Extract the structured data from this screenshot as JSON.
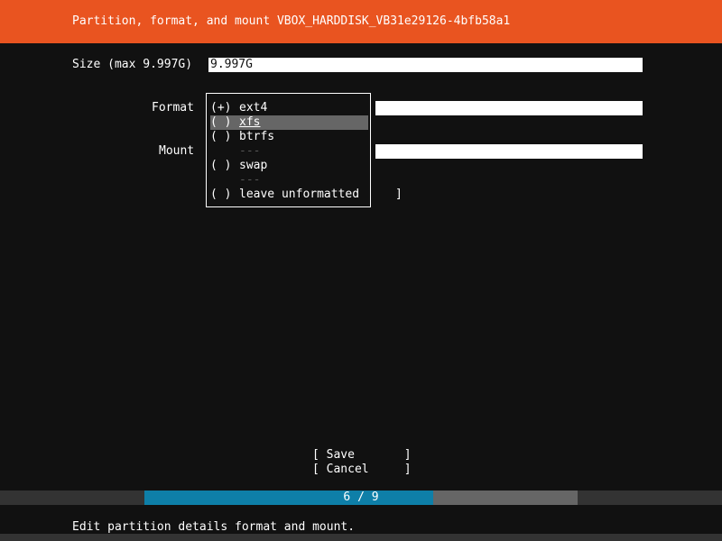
{
  "header": {
    "title": "Partition, format, and mount VBOX_HARDDISK_VB31e29126-4bfb58a1",
    "color": "#e95420"
  },
  "form": {
    "size_label": "Size (max 9.997G)",
    "size_value": "9.997G",
    "format_label": "Format",
    "mount_label": "Mount",
    "mount_right_bracket": "]"
  },
  "format_dropdown": {
    "options": [
      {
        "mark": "(+)",
        "label": "ext4"
      },
      {
        "mark": "( )",
        "label": "xfs",
        "selected": true
      },
      {
        "mark": "( )",
        "label": "btrfs"
      },
      {
        "mark": "( )",
        "label": "swap"
      },
      {
        "mark": "( )",
        "label": "leave unformatted"
      }
    ],
    "separator": "---"
  },
  "buttons": {
    "save": "[ Save       ]",
    "cancel": "[ Cancel     ]"
  },
  "progress": {
    "text": "6 / 9",
    "current": 6,
    "total": 9,
    "fill_color": "#0e7fa8"
  },
  "footer": {
    "help": "Edit partition details format and mount."
  }
}
